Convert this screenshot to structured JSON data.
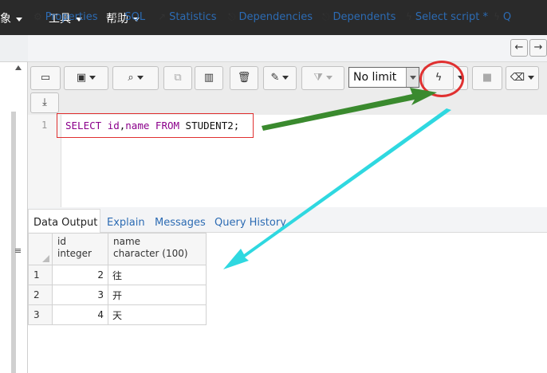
{
  "menu": {
    "items": [
      {
        "label": "对象"
      },
      {
        "label": "工具"
      },
      {
        "label": "帮助"
      }
    ]
  },
  "tabs": [
    {
      "label": "Properties",
      "icon": "properties-icon"
    },
    {
      "label": "SQL",
      "icon": "sql-icon"
    },
    {
      "label": "Statistics",
      "icon": "statistics-icon"
    },
    {
      "label": "Dependencies",
      "icon": "dependencies-icon"
    },
    {
      "label": "Dependents",
      "icon": "dependents-icon"
    },
    {
      "label": "Select script *",
      "icon": "lightning-icon"
    },
    {
      "label": "Q",
      "icon": "lightning-icon"
    }
  ],
  "toolbar": {
    "limit_value": "No limit",
    "execute_icon": "lightning-icon"
  },
  "editor": {
    "line_number": "1",
    "sql_tokens": [
      {
        "text": "SELECT ",
        "kind": "kw"
      },
      {
        "text": "id",
        "kind": "id"
      },
      {
        "text": ",",
        "kind": "plain"
      },
      {
        "text": "name",
        "kind": "id"
      },
      {
        "text": " ",
        "kind": "plain"
      },
      {
        "text": "FROM",
        "kind": "kw"
      },
      {
        "text": " STUDENT2;",
        "kind": "plain"
      }
    ]
  },
  "results": {
    "tabs": [
      {
        "label": "Data Output",
        "active": true
      },
      {
        "label": "Explain"
      },
      {
        "label": "Messages"
      },
      {
        "label": "Query History"
      }
    ],
    "columns": [
      {
        "name": "id",
        "type": "integer"
      },
      {
        "name": "name",
        "type": "character (100)"
      }
    ],
    "rows": [
      {
        "no": "1",
        "id": "2",
        "name": "往"
      },
      {
        "no": "2",
        "id": "3",
        "name": "开"
      },
      {
        "no": "3",
        "id": "4",
        "name": "天"
      }
    ]
  },
  "colors": {
    "menubar_bg": "#2a2a2a",
    "link_blue": "#2c6bb3",
    "highlight_red": "#e03030",
    "arrow_green": "#3a8a2e",
    "arrow_cyan": "#2fd8e0"
  }
}
